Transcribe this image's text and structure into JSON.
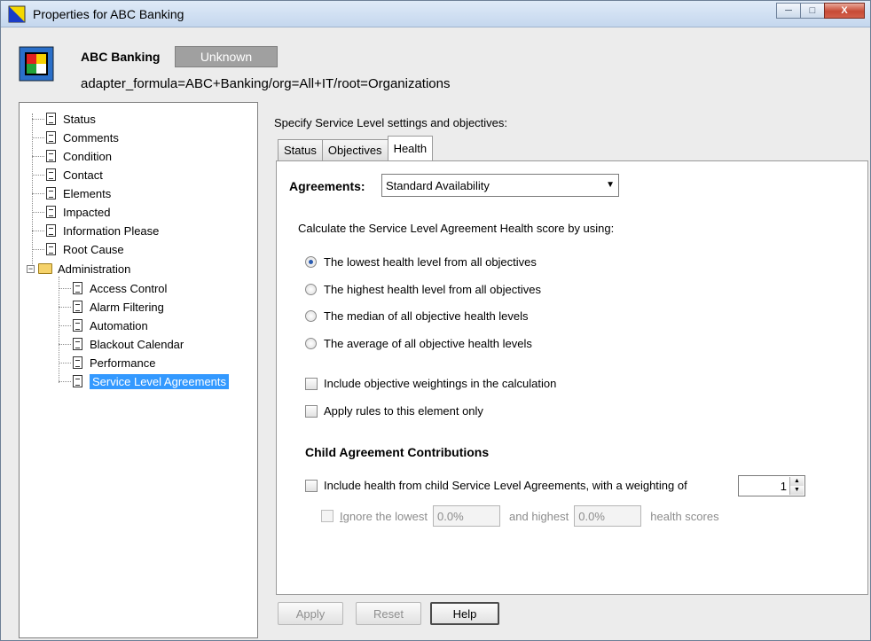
{
  "window": {
    "title": "Properties for ABC Banking",
    "controls": {
      "minimize": "─",
      "maximize": "□",
      "close": "X"
    }
  },
  "header": {
    "org_name": "ABC Banking",
    "status": "Unknown",
    "formula": "adapter_formula=ABC+Banking/org=All+IT/root=Organizations"
  },
  "tree": {
    "items": [
      {
        "label": "Status"
      },
      {
        "label": "Comments"
      },
      {
        "label": "Condition"
      },
      {
        "label": "Contact"
      },
      {
        "label": "Elements"
      },
      {
        "label": "Impacted"
      },
      {
        "label": "Information Please"
      },
      {
        "label": "Root Cause"
      },
      {
        "label": "Administration"
      },
      {
        "label": "Access Control"
      },
      {
        "label": "Alarm Filtering"
      },
      {
        "label": "Automation"
      },
      {
        "label": "Blackout Calendar"
      },
      {
        "label": "Performance"
      },
      {
        "label": "Service Level Agreements"
      }
    ],
    "expander_symbol": "−"
  },
  "main": {
    "instruction": "Specify Service Level settings and objectives:",
    "tabs": [
      {
        "label": "Status"
      },
      {
        "label": "Objectives"
      },
      {
        "label": "Health"
      }
    ],
    "agreements": {
      "label": "Agreements:",
      "selected": "Standard Availability",
      "arrow": "▼"
    },
    "calc_label": "Calculate the Service Level Agreement Health score by using:",
    "options": [
      {
        "label": "The lowest health level from all objectives",
        "selected": true
      },
      {
        "label": "The highest health level from all objectives",
        "selected": false
      },
      {
        "label": "The median of all objective health levels",
        "selected": false
      },
      {
        "label": "The average of all objective health levels",
        "selected": false
      }
    ],
    "checks": [
      {
        "label": "Include objective weightings in the calculation",
        "checked": false
      },
      {
        "label": "Apply rules to this element only",
        "checked": false
      }
    ],
    "child_section": {
      "title": "Child Agreement Contributions",
      "include_label": "Include health from child Service Level Agreements, with a weighting of",
      "weighting": "1",
      "ignore_label_prefix": "I",
      "ignore_label": "gnore the lowest",
      "lowest_value": "0.0%",
      "and_highest": "and highest",
      "highest_value": "0.0%",
      "health_scores": "health scores"
    }
  },
  "buttons": {
    "apply": "Apply",
    "reset": "Reset",
    "help": "Help"
  }
}
